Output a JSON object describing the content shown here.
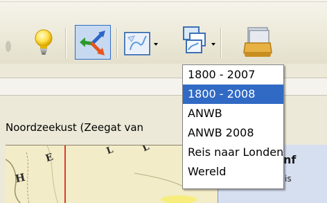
{
  "toolbar": {
    "icons": {
      "partial": "partial-toolbar-icon",
      "hint": "lightbulb-icon",
      "route": "route-arrows-icon",
      "region": "map-region-icon",
      "mapset": "map-set-icon",
      "stack": "map-stack-icon"
    }
  },
  "map": {
    "title": "Noordzeekust (Zeegat van",
    "letters": [
      "H",
      "E",
      "L",
      "L"
    ]
  },
  "right_panel": {
    "label_1": "nf",
    "label_2": "is"
  },
  "dropdown": {
    "items": [
      "1800 - 2007",
      "1800 - 2008",
      "ANWB",
      "ANWB 2008",
      "Reis naar Londen",
      "Wereld"
    ],
    "selected_index": 1
  },
  "colors": {
    "selection": "#316ac5",
    "toolbar": "#ece9d8",
    "map_paper": "#f3ecc8",
    "map_red_line": "#e0392b"
  }
}
